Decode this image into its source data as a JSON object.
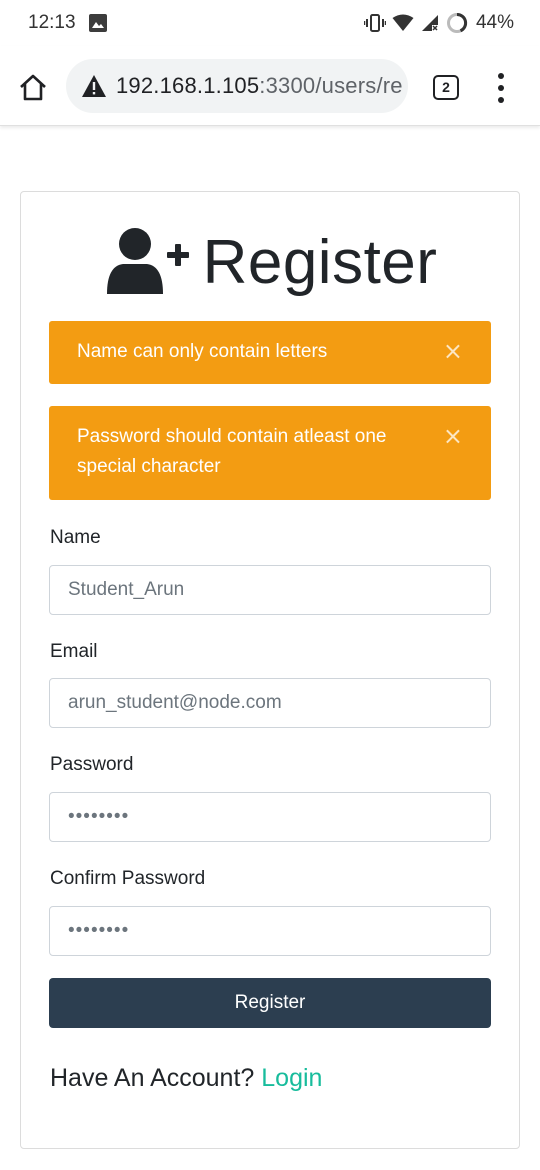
{
  "status_bar": {
    "time": "12:13",
    "battery_pct": "44%",
    "icons": [
      "image-icon",
      "vibrate-icon",
      "wifi-icon",
      "signal-icon",
      "battery-icon"
    ]
  },
  "browser": {
    "url_host": "192.168.1.105",
    "url_path": ":3300/users/re",
    "tab_count": "2",
    "icons": [
      "home-icon",
      "warning-icon",
      "tabs-icon",
      "more-vert-icon"
    ]
  },
  "form": {
    "title": "Register",
    "title_icon": "user-plus-icon",
    "alerts": [
      {
        "text": "Name can only contain letters",
        "close": "×"
      },
      {
        "text": "Password should contain atleast one special character",
        "close": "×"
      }
    ],
    "fields": {
      "name": {
        "label": "Name",
        "value": "Student_Arun"
      },
      "email": {
        "label": "Email",
        "value": "arun_student@node.com"
      },
      "password": {
        "label": "Password",
        "value": "••••••••"
      },
      "confirm_password": {
        "label": "Confirm Password",
        "value": "••••••••"
      }
    },
    "submit_label": "Register",
    "account_prompt": "Have An Account? ",
    "login_label": "Login"
  },
  "colors": {
    "alert": "#f39c12",
    "button": "#2c3e50",
    "link": "#18bc9c"
  }
}
